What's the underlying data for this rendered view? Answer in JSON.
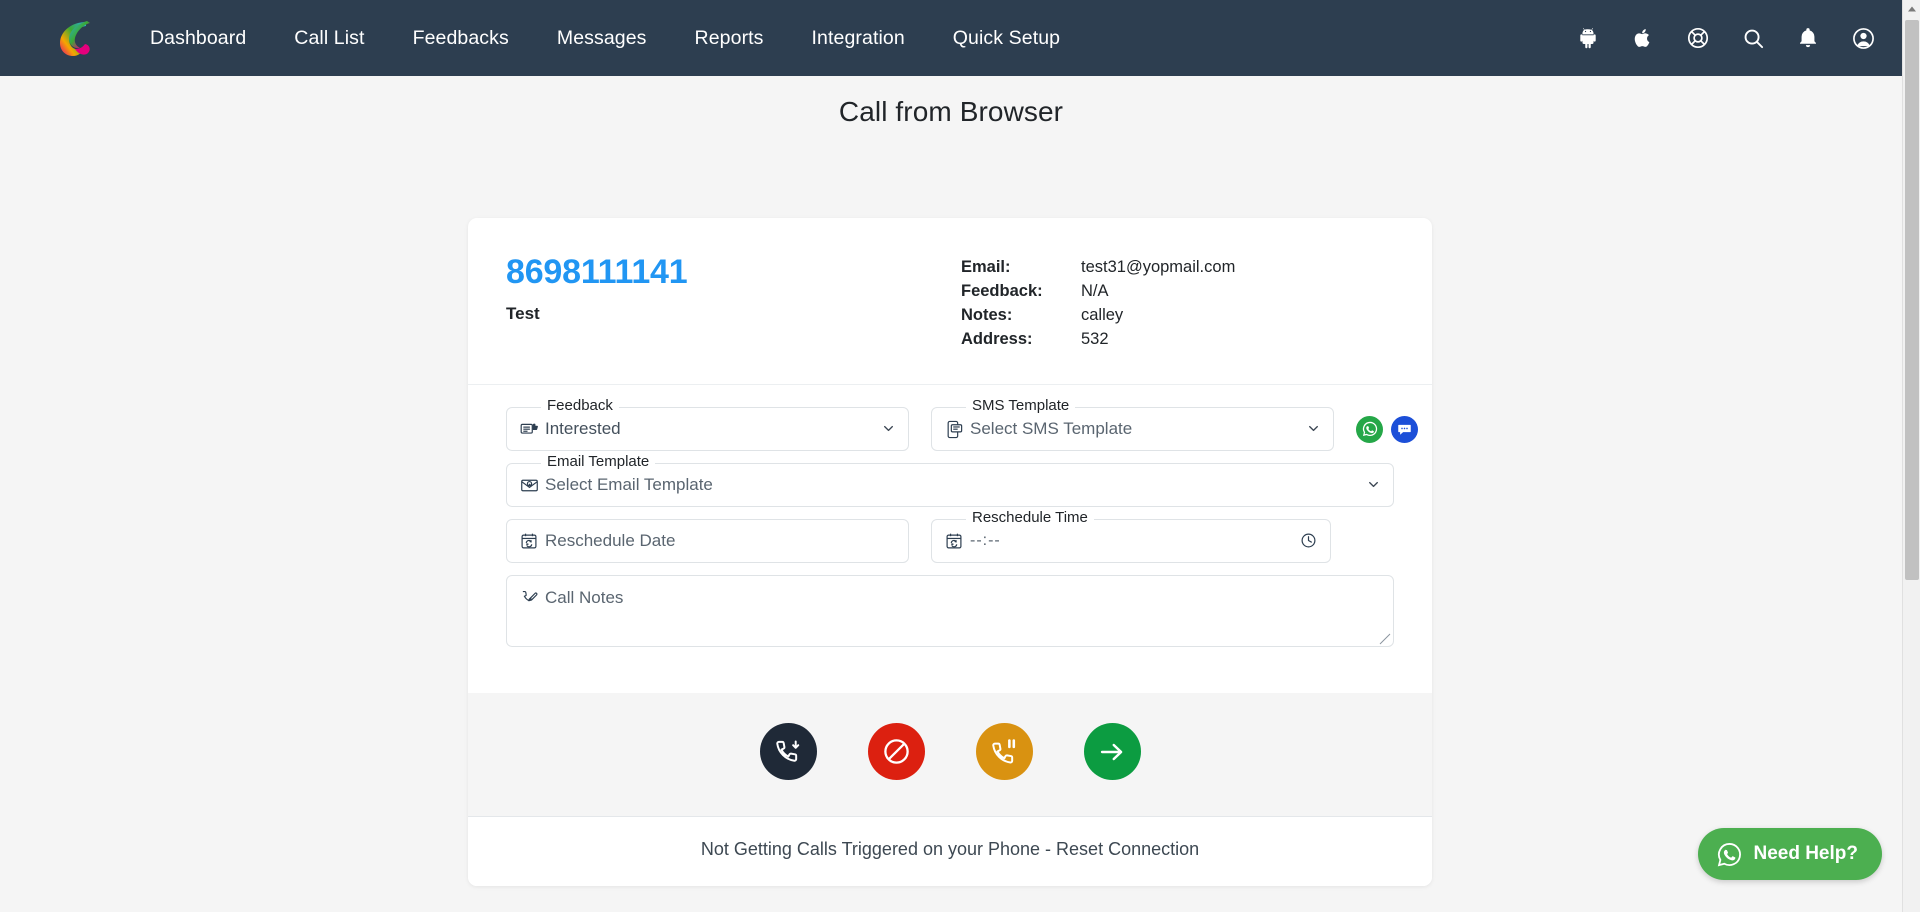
{
  "navbar": {
    "logo_name": "calley-logo",
    "links": [
      {
        "label": "Dashboard"
      },
      {
        "label": "Call List"
      },
      {
        "label": "Feedbacks"
      },
      {
        "label": "Messages"
      },
      {
        "label": "Reports"
      },
      {
        "label": "Integration"
      },
      {
        "label": "Quick Setup"
      }
    ],
    "icons": [
      {
        "name": "android-icon"
      },
      {
        "name": "apple-icon"
      },
      {
        "name": "lifebuoy-support-icon"
      },
      {
        "name": "search-icon"
      },
      {
        "name": "bell-notification-icon"
      },
      {
        "name": "user-account-icon"
      }
    ],
    "background": "#2d3e50"
  },
  "page": {
    "title": "Call from Browser",
    "background": "#f5f5f5"
  },
  "contact": {
    "phone": "8698111141",
    "name": "Test",
    "accent_color": "#2196f3",
    "details": [
      {
        "label": "Email:",
        "value": "test31@yopmail.com"
      },
      {
        "label": "Feedback:",
        "value": "N/A"
      },
      {
        "label": "Notes:",
        "value": "calley"
      },
      {
        "label": "Address:",
        "value": "532"
      }
    ]
  },
  "form": {
    "feedback": {
      "legend": "Feedback",
      "value": "Interested",
      "icon": "feedback-comment-icon"
    },
    "sms_template": {
      "legend": "SMS Template",
      "value": "Select SMS Template",
      "icon": "mobile-message-icon"
    },
    "whatsapp_button": {
      "name": "whatsapp-send-button",
      "color": "#25a748"
    },
    "sms_button": {
      "name": "sms-send-button",
      "color": "#1c4fd8"
    },
    "email_template": {
      "legend": "Email Template",
      "value": "Select Email Template",
      "icon": "email-envelope-icon"
    },
    "reschedule_date": {
      "legend": "",
      "placeholder": "Reschedule Date",
      "icon": "calendar-refresh-icon"
    },
    "reschedule_time": {
      "legend": "Reschedule Time",
      "value": "--:--",
      "icon": "calendar-refresh-icon",
      "trailing_icon": "clock-icon"
    },
    "call_notes": {
      "placeholder": "Call Notes",
      "icon": "phone-edit-icon"
    }
  },
  "actions": [
    {
      "name": "answer-call-button",
      "icon": "phone-incoming-icon",
      "color": "#1f2937"
    },
    {
      "name": "reject-call-button",
      "icon": "block-prohibited-icon",
      "color": "#dc2010"
    },
    {
      "name": "hold-call-button",
      "icon": "phone-pause-icon",
      "color": "#d99211"
    },
    {
      "name": "next-call-button",
      "icon": "arrow-right-icon",
      "color": "#0c9c41"
    }
  ],
  "footer": {
    "reset_link": "Not Getting Calls Triggered on your Phone - Reset Connection"
  },
  "need_help": {
    "label": "Need Help?",
    "icon": "whatsapp-icon",
    "color": "#4caf50"
  }
}
